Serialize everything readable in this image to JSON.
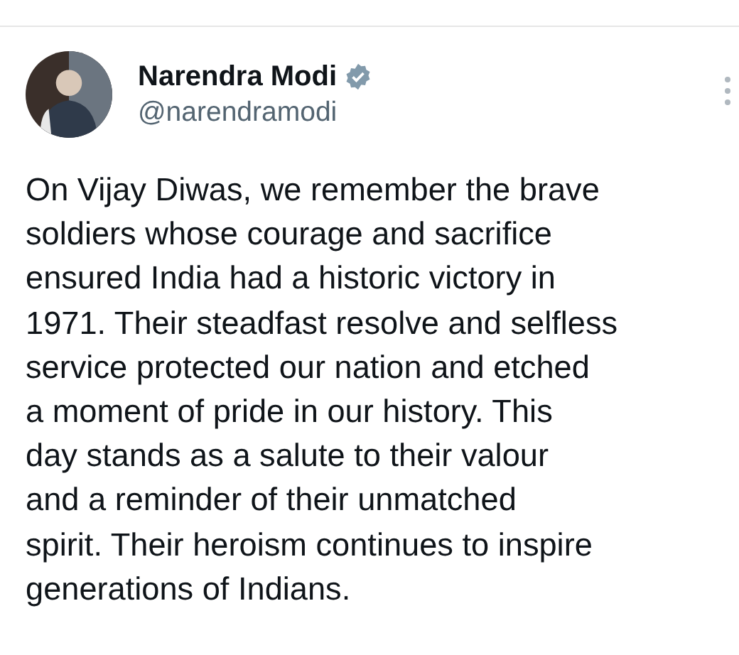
{
  "author": {
    "name": "Narendra Modi",
    "handle": "@narendramodi",
    "verified": true
  },
  "post": {
    "lines": [
      "On Vijay Diwas, we remember the brave",
      "soldiers whose courage and sacrifice",
      "ensured India had a historic victory in",
      "1971. Their steadfast resolve and selfless",
      "service protected our nation and etched",
      "a moment of pride in our history. This",
      "day stands as a salute to their valour",
      "and a reminder of their unmatched",
      "spirit. Their heroism continues to inspire",
      "generations of Indians."
    ]
  }
}
